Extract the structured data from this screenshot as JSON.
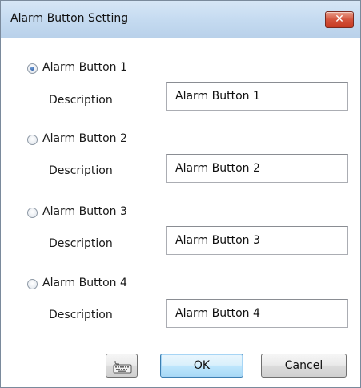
{
  "window": {
    "title": "Alarm Button Setting",
    "close_glyph": "✕"
  },
  "alarms": [
    {
      "label": "Alarm Button 1",
      "description_label": "Description",
      "description_value": "Alarm Button 1",
      "selected": true
    },
    {
      "label": "Alarm Button 2",
      "description_label": "Description",
      "description_value": "Alarm Button 2",
      "selected": false
    },
    {
      "label": "Alarm Button 3",
      "description_label": "Description",
      "description_value": "Alarm Button 3",
      "selected": false
    },
    {
      "label": "Alarm Button 4",
      "description_label": "Description",
      "description_value": "Alarm Button 4",
      "selected": false
    }
  ],
  "buttons": {
    "keyboard_icon": "keyboard-icon",
    "ok": "OK",
    "cancel": "Cancel"
  },
  "colors": {
    "titlebar": "#c4daf0",
    "close": "#d4543d",
    "ok_border": "#3c7fb1"
  }
}
